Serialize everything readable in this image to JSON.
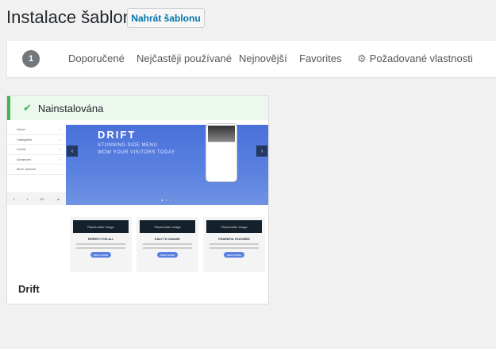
{
  "header": {
    "title": "Instalace šablon",
    "upload_label": "Nahrát šablonu"
  },
  "nav": {
    "count": "1",
    "tabs": [
      "Doporučené",
      "Nejčastěji používané",
      "Nejnovější",
      "Favorites"
    ],
    "feature_filter": "Požadované vlastnosti"
  },
  "theme": {
    "status": "Nainstalována",
    "name": "Drift",
    "preview": {
      "menu": [
        "Home",
        "Categories",
        "Levels",
        "Advanced",
        "More Options"
      ],
      "social": [
        "f",
        "t",
        "G+",
        "in"
      ],
      "hero_title": "DRIFT",
      "hero_line1": "STUNNING SIDE MENU",
      "hero_line2": "WOW YOUR VISITORS TODAY",
      "placeholder": "Placeholder Image",
      "features": [
        "PERFECT FOR ALL",
        "EASY TO CHANGE",
        "POWERFUL FEATURES"
      ],
      "button": "READ MORE"
    }
  },
  "colors": {
    "accent": "#0073aa",
    "success": "#46b450"
  }
}
